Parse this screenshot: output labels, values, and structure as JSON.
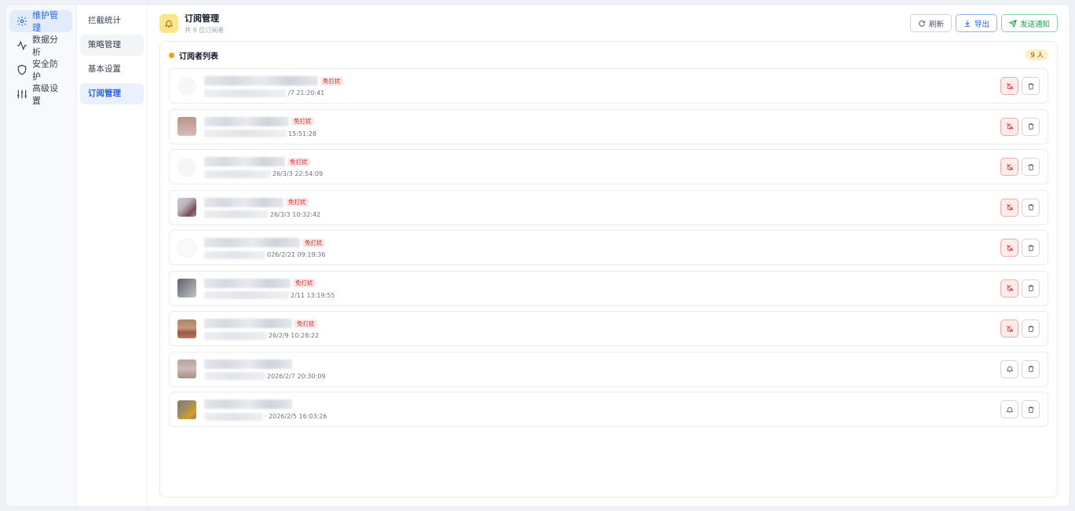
{
  "sidebar": {
    "items": [
      {
        "label": "维护管理",
        "icon": "gear-icon",
        "active": true
      },
      {
        "label": "数据分析",
        "icon": "activity-icon",
        "active": false
      },
      {
        "label": "安全防护",
        "icon": "shield-icon",
        "active": false
      },
      {
        "label": "高级设置",
        "icon": "sliders-icon",
        "active": false
      }
    ]
  },
  "subnav": {
    "items": [
      {
        "label": "拦截统计"
      },
      {
        "label": "策略管理"
      },
      {
        "label": "基本设置"
      },
      {
        "label": "订阅管理"
      }
    ]
  },
  "header": {
    "title": "订阅管理",
    "subtitle": "共 9 位订阅者",
    "refresh_label": "刷新",
    "export_label": "导出",
    "send_label": "发送通知"
  },
  "list": {
    "title": "订阅者列表",
    "count": "9 人",
    "dnd_tag": "免打扰",
    "rows": [
      {
        "time": "/7 21:20:41",
        "dnd": true
      },
      {
        "time": "15:51:28",
        "dnd": true
      },
      {
        "time": "26/3/3 22:54:09",
        "dnd": true
      },
      {
        "time": "26/3/3 10:32:42",
        "dnd": true
      },
      {
        "time": "026/2/21 09:19:36",
        "dnd": true
      },
      {
        "time": "2/11 13:19:55",
        "dnd": true
      },
      {
        "time": "26/2/9 10:28:22",
        "dnd": true
      },
      {
        "time": "2026/2/7 20:30:09",
        "dnd": false
      },
      {
        "time": "· 2026/2/5 16:03:26",
        "dnd": false
      }
    ]
  }
}
